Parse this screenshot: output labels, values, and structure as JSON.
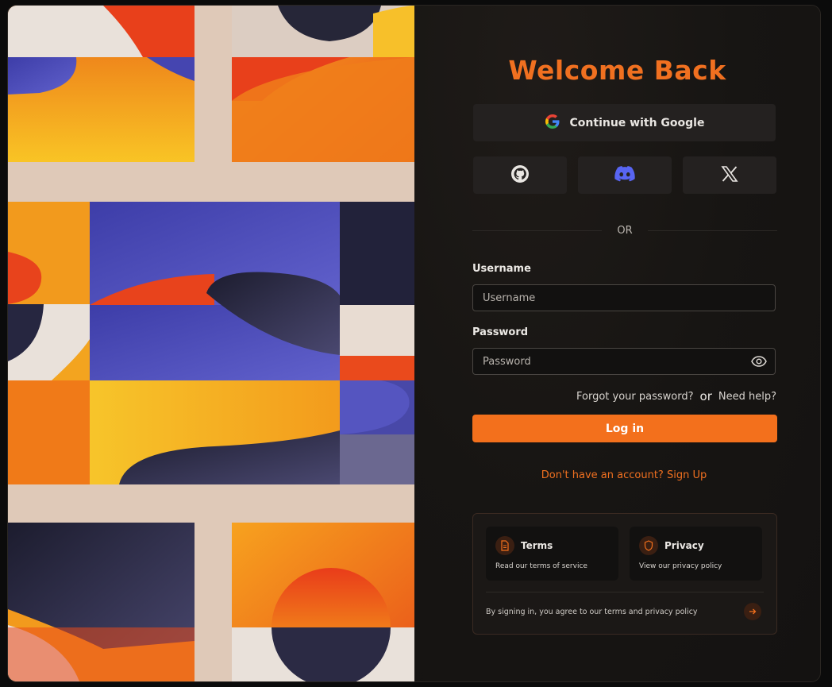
{
  "login": {
    "title": "Welcome Back",
    "google_label": "Continue with Google",
    "social_icons": [
      "github-icon",
      "discord-icon",
      "x-icon"
    ],
    "or_label": "OR",
    "username_label": "Username",
    "username_placeholder": "Username",
    "password_label": "Password",
    "password_placeholder": "Password",
    "forgot_label": "Forgot your password?",
    "or_small": "or",
    "help_label": "Need help?",
    "login_label": "Log in",
    "signup_label": "Don't have an account? Sign Up"
  },
  "policy": {
    "terms_title": "Terms",
    "terms_sub": "Read our terms of service",
    "privacy_title": "Privacy",
    "privacy_sub": "View our privacy policy",
    "agree_text": "By signing in, you agree to our terms and privacy policy"
  },
  "colors": {
    "accent": "#f3701c",
    "panel_bg": "#171513",
    "art_cream": "#dfc9b8",
    "art_blue": "#4f4fb8",
    "art_navy": "#262640",
    "art_orange": "#ef7a18",
    "art_red": "#e8431c",
    "art_yellow": "#f7bd22"
  }
}
